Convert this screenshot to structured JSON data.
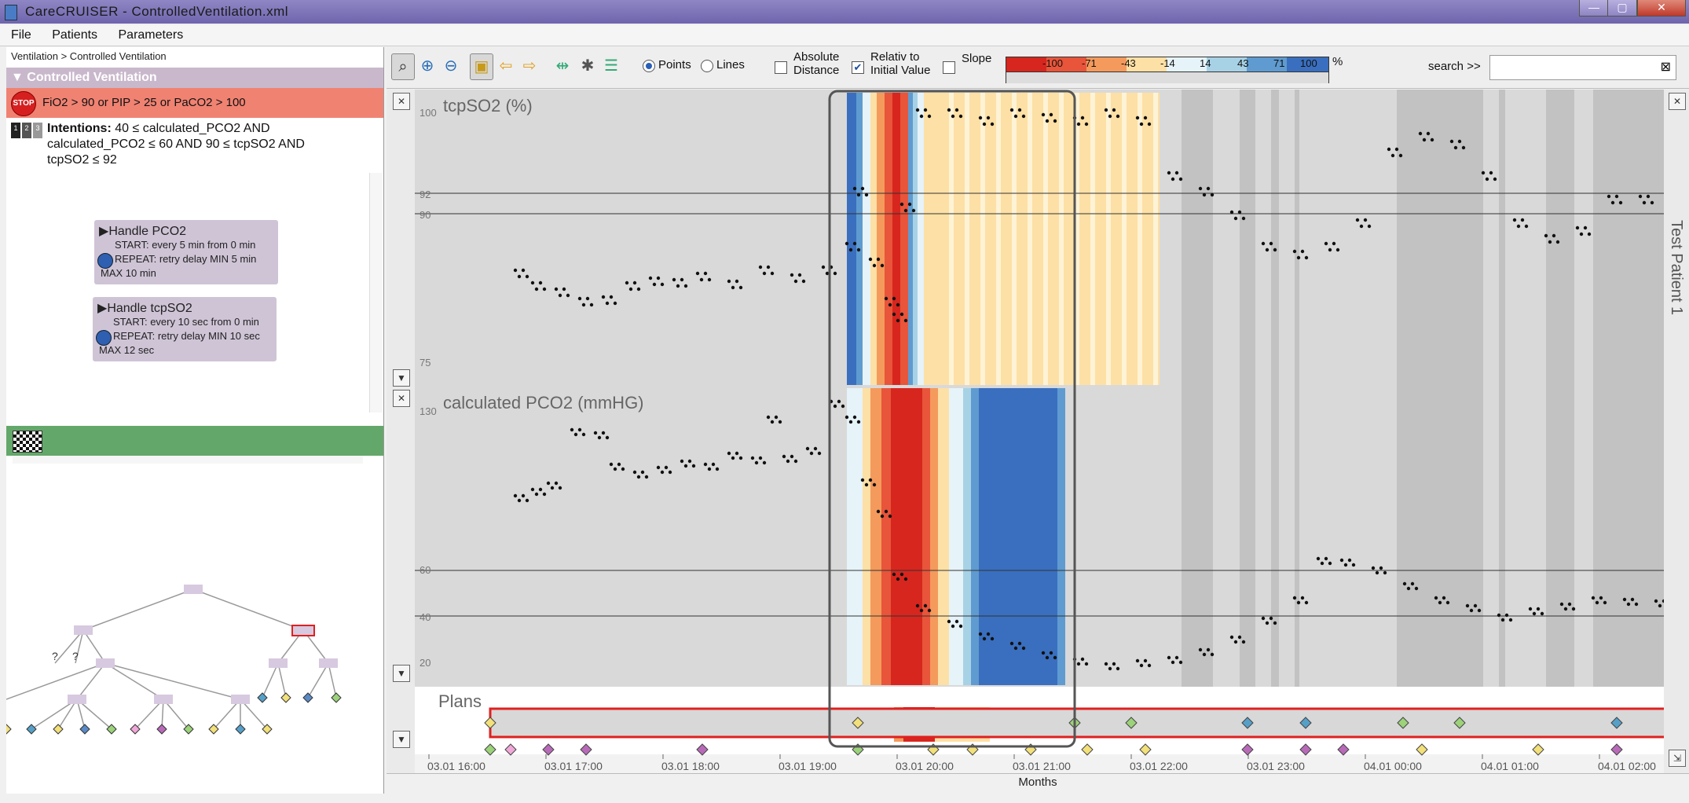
{
  "window": {
    "title": "CareCRUISER - ControlledVentilation.xml"
  },
  "menu": [
    "File",
    "Patients",
    "Parameters"
  ],
  "left": {
    "breadcrumb": "Ventilation > Controlled Ventilation",
    "section_title": "Controlled Ventilation",
    "stop_icon_text": "STOP",
    "stop_condition": "FiO2 > 90 or PIP > 25 or PaCO2 > 100",
    "intention_label": "Intentions:",
    "intention_line1": "40 ≤ calculated_PCO2 AND",
    "intention_line2": "calculated_PCO2 ≤ 60 AND 90 ≤ tcpSO2 AND",
    "intention_line3": "tcpSO2 ≤ 92",
    "badges": [
      "1",
      "2",
      "3"
    ],
    "plans": [
      {
        "name": "Handle PCO2",
        "start": "START: every 5 min from 0 min",
        "repeat": "REPEAT: retry delay MIN 5 min",
        "max": "MAX 10 min"
      },
      {
        "name": "Handle tcpSO2",
        "start": "START: every 10 sec from 0 min",
        "repeat": "REPEAT: retry delay MIN 10 sec",
        "max": "MAX 12 sec"
      }
    ],
    "tree_unknown_marks": [
      "?",
      "?"
    ]
  },
  "toolbar": {
    "points_label": "Points",
    "lines_label": "Lines",
    "absolute_line1": "Absolute",
    "absolute_line2": "Distance",
    "relative_line1": "Relativ to",
    "relative_line2": "Initial Value",
    "slope_label": "Slope",
    "search_label": "search >>",
    "search_value": "",
    "legend_unit": "%",
    "legend_ticks": [
      "-100",
      "-71",
      "-43",
      "-14",
      "14",
      "43",
      "71",
      "100"
    ],
    "legend_colors": [
      "#d7261e",
      "#e8553a",
      "#f49a5c",
      "#fde0a5",
      "#e6f3f8",
      "#a7d2e6",
      "#5f9bd0",
      "#3a6fbf"
    ],
    "relative_checked": true
  },
  "chart": {
    "panel1_title": "tcpSO2 (%)",
    "panel2_title": "calculated PCO2 (mmHG)",
    "plans_title": "Plans",
    "patient_label": "Test Patient 1",
    "status": "Months",
    "y1_ticks": [
      "100",
      "92",
      "90",
      "75"
    ],
    "y2_ticks": [
      "130",
      "60",
      "40",
      "20"
    ],
    "x_ticks": [
      "03.01 16:00",
      "03.01 17:00",
      "03.01 18:00",
      "03.01 19:00",
      "03.01 20:00",
      "03.01 21:00",
      "03.01 22:00",
      "03.01 23:00",
      "04.01 00:00",
      "04.01 01:00",
      "04.01 02:00"
    ]
  }
}
